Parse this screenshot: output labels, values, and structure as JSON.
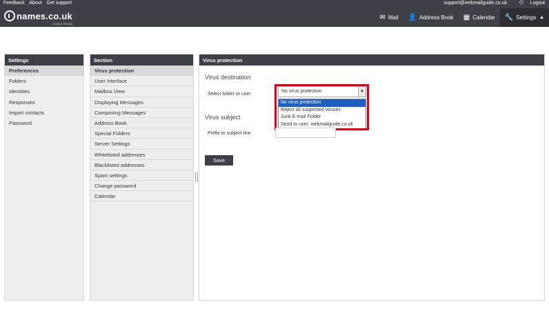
{
  "topbar": {
    "links": [
      "Feedback",
      "About",
      "Get support"
    ],
    "email": "support@webmailguide.co.uk",
    "logout": "Logout"
  },
  "brand": {
    "name": "names.co.uk",
    "tagline": "A DADA BRAND"
  },
  "nav": [
    {
      "label": "Mail",
      "icon": "envelope-icon"
    },
    {
      "label": "Address Book",
      "icon": "person-icon"
    },
    {
      "label": "Calendar",
      "icon": "calendar-icon"
    },
    {
      "label": "Settings",
      "icon": "wrench-icon",
      "active": true
    }
  ],
  "settings": {
    "title": "Settings",
    "items": [
      "Preferences",
      "Folders",
      "Identities",
      "Responses",
      "Import contacts",
      "Password"
    ],
    "selected": "Preferences"
  },
  "section": {
    "title": "Section",
    "items": [
      "Virus protection",
      "User Interface",
      "Mailbox View",
      "Displaying Messages",
      "Composing Messages",
      "Address Book",
      "Special Folders",
      "Server Settings",
      "Whitelisted addresses",
      "Blacklisted addresses",
      "Spam settings",
      "Change password",
      "Calendar"
    ],
    "selected": "Virus protection"
  },
  "main": {
    "title": "Virus protection",
    "destination_heading": "Virus destination",
    "folder_label": "Select folder or user",
    "select_value": "No virus protection",
    "options": [
      "No virus protection",
      "Reject all suspected viruses",
      "Junk E-mail Folder",
      "Send to user: webmailguide.co.uk"
    ],
    "subject_heading": "Virus subject",
    "prefix_label": "Prefix to subject line",
    "prefix_value": "",
    "save_label": "Save"
  },
  "colors": {
    "header": "#3d4046",
    "highlight": "#1e5fc2",
    "annotation": "#e0001b"
  }
}
